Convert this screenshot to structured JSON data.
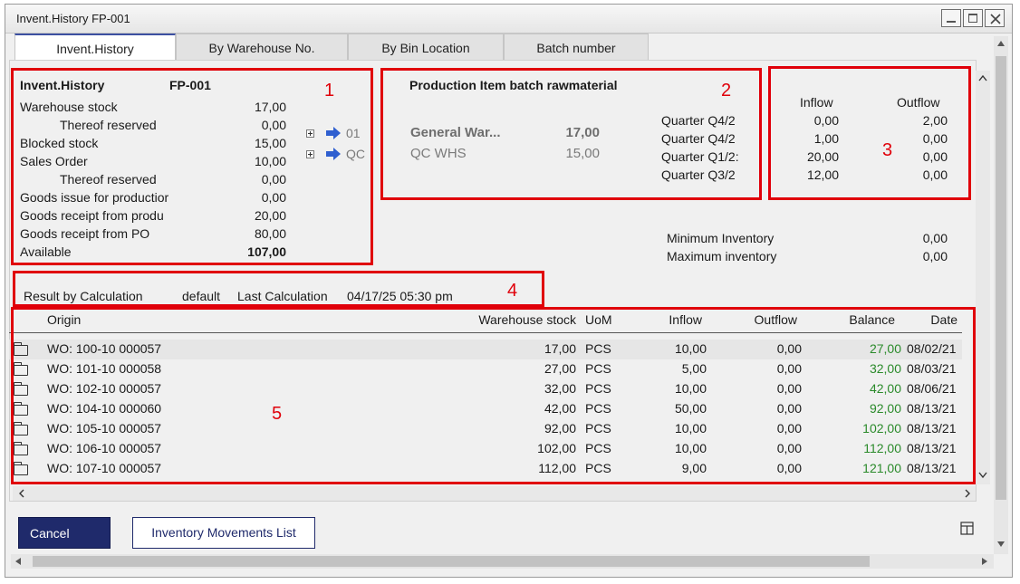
{
  "window": {
    "title": "Invent.History FP-001",
    "controls": [
      "minimize",
      "maximize",
      "close"
    ]
  },
  "tabs": [
    {
      "label": "Invent.History",
      "active": true
    },
    {
      "label": "By Warehouse No.",
      "active": false
    },
    {
      "label": "By Bin Location",
      "active": false
    },
    {
      "label": "Batch number",
      "active": false
    }
  ],
  "summary": {
    "title": "Invent.History",
    "item_code": "FP-001",
    "rows": [
      {
        "label": "Warehouse stock",
        "value": "17,00"
      },
      {
        "label": "Thereof reserved",
        "value": "0,00"
      },
      {
        "label": "Blocked stock",
        "value": "15,00"
      },
      {
        "label": "Sales Order",
        "value": "10,00"
      },
      {
        "label": "Thereof reserved",
        "value": "0,00"
      },
      {
        "label": "Goods issue for productior",
        "value": "0,00"
      },
      {
        "label": "Goods receipt from produ",
        "value": "20,00"
      },
      {
        "label": "Goods receipt from PO",
        "value": "80,00"
      },
      {
        "label": "Available",
        "value": "107,00"
      }
    ],
    "warehouse_links": [
      {
        "label": "01"
      },
      {
        "label": "QC"
      }
    ]
  },
  "item_panel": {
    "description": "Production Item batch rawmaterial",
    "warehouses": [
      {
        "name": "General War...",
        "qty": "17,00"
      },
      {
        "name": "QC WHS",
        "qty": "15,00"
      }
    ],
    "quarters": [
      "Quarter Q4/2",
      "Quarter Q4/2",
      "Quarter Q1/2:",
      "Quarter Q3/2"
    ]
  },
  "flow_panel": {
    "inflow_header": "Inflow",
    "outflow_header": "Outflow",
    "rows": [
      {
        "inflow": "0,00",
        "outflow": "2,00"
      },
      {
        "inflow": "1,00",
        "outflow": "0,00"
      },
      {
        "inflow": "20,00",
        "outflow": "0,00"
      },
      {
        "inflow": "12,00",
        "outflow": "0,00"
      }
    ]
  },
  "inventory_limits": {
    "min_label": "Minimum Inventory",
    "min_value": "0,00",
    "max_label": "Maximum inventory",
    "max_value": "0,00"
  },
  "calc": {
    "label": "Result by Calculation",
    "mode": "default",
    "last_label": "Last Calculation",
    "last_value": "04/17/25 05:30 pm"
  },
  "grid": {
    "columns": {
      "origin": "Origin",
      "warehouse_stock": "Warehouse stock",
      "uom": "UoM",
      "inflow": "Inflow",
      "outflow": "Outflow",
      "balance": "Balance",
      "date": "Date"
    },
    "rows": [
      {
        "origin": "WO: 100-10 000057",
        "stock": "17,00",
        "uom": "PCS",
        "inflow": "10,00",
        "outflow": "0,00",
        "balance": "27,00",
        "date": "08/02/21"
      },
      {
        "origin": "WO: 101-10 000058",
        "stock": "27,00",
        "uom": "PCS",
        "inflow": "5,00",
        "outflow": "0,00",
        "balance": "32,00",
        "date": "08/03/21"
      },
      {
        "origin": "WO: 102-10 000057",
        "stock": "32,00",
        "uom": "PCS",
        "inflow": "10,00",
        "outflow": "0,00",
        "balance": "42,00",
        "date": "08/06/21"
      },
      {
        "origin": "WO: 104-10 000060",
        "stock": "42,00",
        "uom": "PCS",
        "inflow": "50,00",
        "outflow": "0,00",
        "balance": "92,00",
        "date": "08/13/21"
      },
      {
        "origin": "WO: 105-10 000057",
        "stock": "92,00",
        "uom": "PCS",
        "inflow": "10,00",
        "outflow": "0,00",
        "balance": "102,00",
        "date": "08/13/21"
      },
      {
        "origin": "WO: 106-10 000057",
        "stock": "102,00",
        "uom": "PCS",
        "inflow": "10,00",
        "outflow": "0,00",
        "balance": "112,00",
        "date": "08/13/21"
      },
      {
        "origin": "WO: 107-10 000057",
        "stock": "112,00",
        "uom": "PCS",
        "inflow": "9,00",
        "outflow": "0,00",
        "balance": "121,00",
        "date": "08/13/21"
      }
    ]
  },
  "callouts": [
    "1",
    "2",
    "3",
    "4",
    "5"
  ],
  "buttons": {
    "cancel": "Cancel",
    "inventory_movements": "Inventory Movements List"
  },
  "colors": {
    "callout_red": "#e0000a",
    "primary_button": "#1f2a6b",
    "balance_green": "#2a8a2a",
    "link_arrow_blue": "#2f5fd0"
  }
}
